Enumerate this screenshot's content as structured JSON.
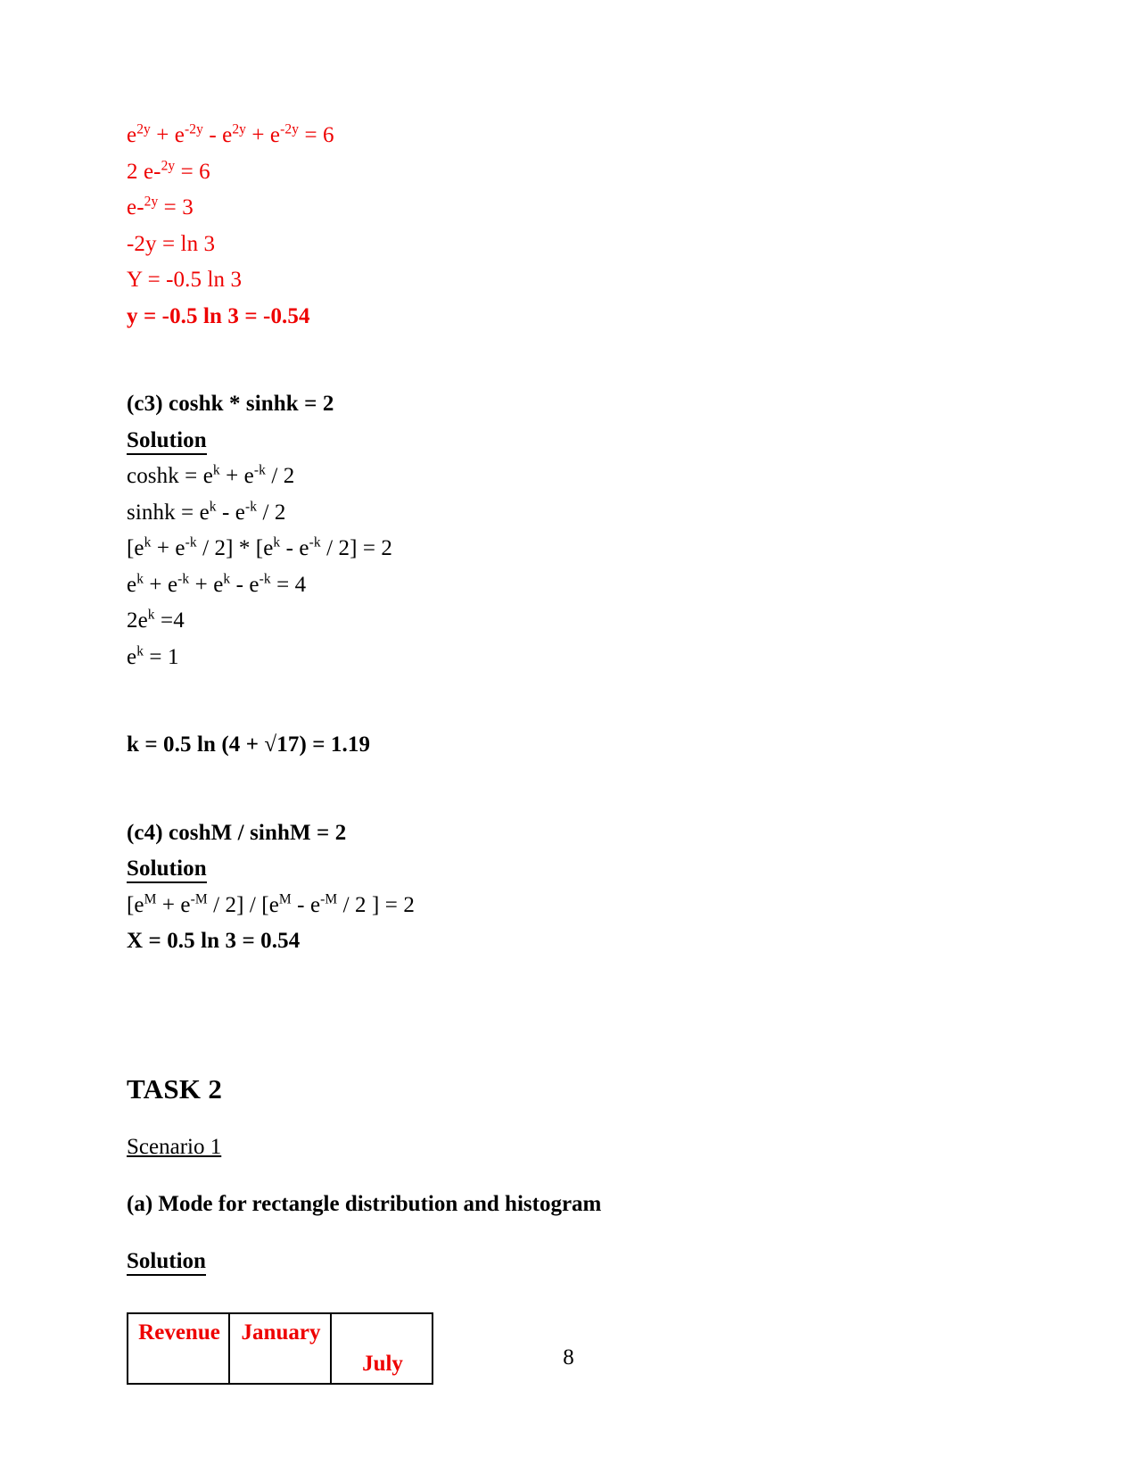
{
  "document": {
    "page_number": "8",
    "accent_red": "#ee0000",
    "text_black": "#000000"
  },
  "section_c2_work": {
    "lines": [
      {
        "pre": "e",
        "sup1": "2y",
        "mid": " + e",
        "sup2": "-2y",
        "mid2": " - e",
        "sup3": "2y",
        "mid3": " + e",
        "sup4": "-2y",
        "post": " = 6"
      }
    ],
    "line1_parts": [
      "e",
      "2y",
      " + e",
      "-2y",
      " - e",
      "2y",
      " + e",
      "-2y",
      " = 6"
    ],
    "line2_parts": [
      "2 e-",
      "2y",
      " = 6"
    ],
    "line3_parts": [
      "e-",
      "2y",
      " = 3"
    ],
    "line4": "-2y = ln 3",
    "line5": "Y = -0.5 ln 3",
    "line6": "y = -0.5 ln 3 = -0.54"
  },
  "section_c3": {
    "question": "(c3) coshk * sinhk = 2",
    "solution_label": "Solution ",
    "work": {
      "l1": [
        "coshk = e",
        "k",
        " + e",
        "-k",
        " / 2"
      ],
      "l2": [
        "sinhk = e",
        "k",
        " - e",
        "-k",
        " / 2"
      ],
      "l3": [
        "[e",
        "k",
        " + e",
        "-k",
        " / 2] * [e",
        "k",
        " - e",
        "-k",
        " / 2] = 2"
      ],
      "l4": [
        "e",
        "k",
        " + e",
        "-k",
        " + e",
        "k",
        " - e",
        "-k",
        " = 4"
      ],
      "l5": [
        "2e",
        "k",
        " =4"
      ],
      "l6": [
        "e",
        "k",
        "  = 1"
      ]
    },
    "answer": "k = 0.5 ln (4 + √17) = 1.19"
  },
  "section_c4": {
    "question": "(c4) coshM / sinhM = 2",
    "solution_label": "Solution ",
    "work": {
      "l1": [
        "[e",
        "M",
        " + e",
        "-M",
        " / 2] / [e",
        "M",
        " - e",
        "-M",
        " / 2 ] = 2"
      ]
    },
    "answer": "X = 0.5 ln 3 = 0.54"
  },
  "task2": {
    "title": "TASK 2",
    "scenario": "Scenario 1",
    "part_a": "(a) Mode for rectangle distribution and histogram",
    "solution_label": "Solution",
    "table": {
      "headers": [
        "Revenue",
        "January",
        "July"
      ]
    }
  }
}
